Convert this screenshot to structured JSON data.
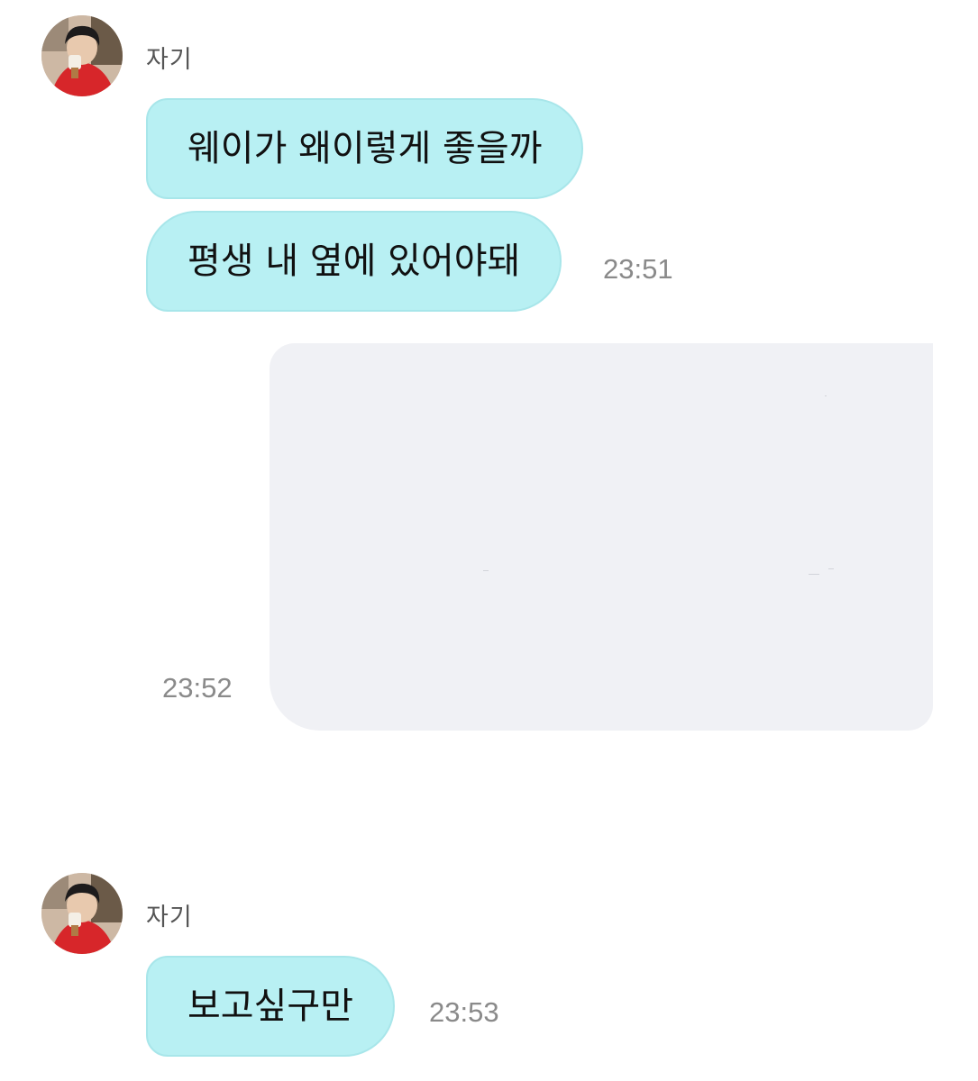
{
  "groups": [
    {
      "sender": "자기",
      "messages": [
        "웨이가 왜이렇게 좋을까",
        "평생 내 옆에 있어야돼"
      ],
      "time": "23:51"
    },
    {
      "sender": "자기",
      "messages": [
        "보고싶구만"
      ],
      "time": "23:53"
    }
  ],
  "outgoing": {
    "time": "23:52"
  },
  "colors": {
    "incoming_bubble": "#b8f0f3",
    "outgoing_image_bg": "#f0f1f5",
    "time_text": "#8a8a8a",
    "name_text": "#555555"
  }
}
